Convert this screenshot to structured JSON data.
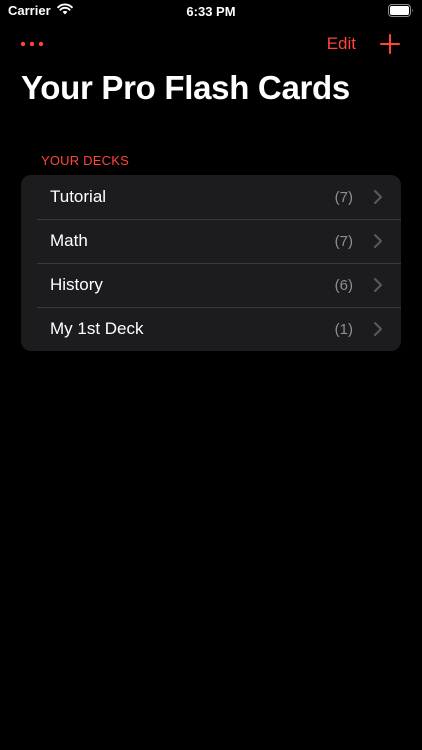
{
  "status_bar": {
    "carrier": "Carrier",
    "time": "6:33 PM"
  },
  "nav": {
    "edit_label": "Edit"
  },
  "title": "Your Pro Flash Cards",
  "section_header": "YOUR DECKS",
  "decks": [
    {
      "name": "Tutorial",
      "count": "(7)"
    },
    {
      "name": "Math",
      "count": "(7)"
    },
    {
      "name": "History",
      "count": "(6)"
    },
    {
      "name": "My 1st Deck",
      "count": "(1)"
    }
  ],
  "colors": {
    "accent": "#ff453a",
    "background": "#000000",
    "cell": "#1c1c1e",
    "secondary_text": "#8e8e93"
  },
  "icons": {
    "wifi": "wifi-icon",
    "battery": "battery-icon",
    "more": "more-icon",
    "add": "plus-icon",
    "chevron": "chevron-right-icon"
  }
}
